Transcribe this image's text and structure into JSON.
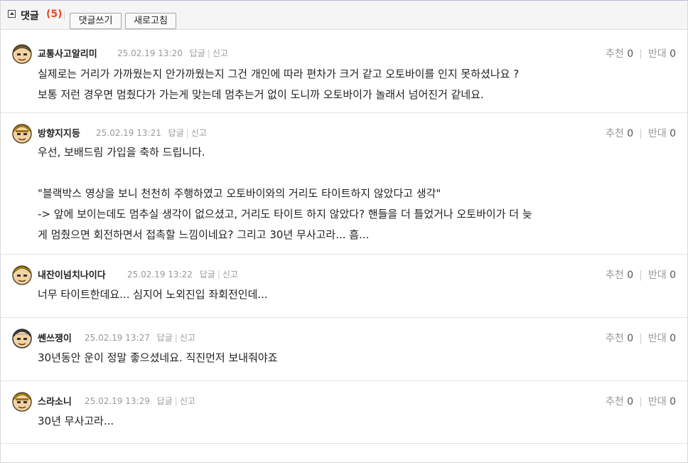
{
  "header": {
    "title": "댓글",
    "count": "(5)",
    "write_button": "댓글쓰기",
    "refresh_button": "새로고침"
  },
  "labels": {
    "reply": "답글",
    "report": "신고",
    "recommend": "추천",
    "oppose": "반대"
  },
  "comments": [
    {
      "nickname": "교통사고알리미",
      "datetime": "25.02.19 13:20",
      "recommend": "0",
      "oppose": "0",
      "avatar_color": "#7a6a3a",
      "lines": [
        "실제로는 거리가 가까웠는지 안가까웠는지 그건 개인에 따라 편차가 크거 같고 오토바이를 인지 못하셨나요 ?",
        "보통 저런 경우면 멈췄다가 가는게 맞는데 멈추는거 없이 도니까 오토바이가 놀래서 넘어진거 같네요."
      ]
    },
    {
      "nickname": "방향지지등",
      "datetime": "25.02.19 13:21",
      "recommend": "0",
      "oppose": "0",
      "avatar_color": "#d9a21b",
      "lines": [
        "우선, 보배드림 가입을 축하 드립니다.",
        "",
        "\"블랙박스 영상을 보니 천천히 주행하였고 오토바이와의 거리도 타이트하지 않았다고 생각\"",
        "-> 앞에 보이는데도 멈추실 생각이 없으셨고, 거리도 타이트 하지 않았다? 핸들을 더 틀었거나 오토바이가 더 늦",
        "게 멈췄으면 회전하면서 접촉할 느낌이네요? 그리고 30년 무사고라... 흠..."
      ]
    },
    {
      "nickname": "내잔이넘치나이다",
      "datetime": "25.02.19 13:22",
      "recommend": "0",
      "oppose": "0",
      "avatar_color": "#c9a21a",
      "lines": [
        "너무 타이트한데요... 심지어 노외진입 좌회전인데..."
      ]
    },
    {
      "nickname": "쎈쓰쟁이",
      "datetime": "25.02.19 13:27",
      "recommend": "0",
      "oppose": "0",
      "avatar_color": "#555555",
      "lines": [
        "30년동안 운이 정말 좋으셨네요. 직진먼저 보내줘야죠"
      ]
    },
    {
      "nickname": "스라소니",
      "datetime": "25.02.19 13:29",
      "recommend": "0",
      "oppose": "0",
      "avatar_color": "#d9a21b",
      "lines": [
        "30년 무사고라..."
      ]
    }
  ]
}
